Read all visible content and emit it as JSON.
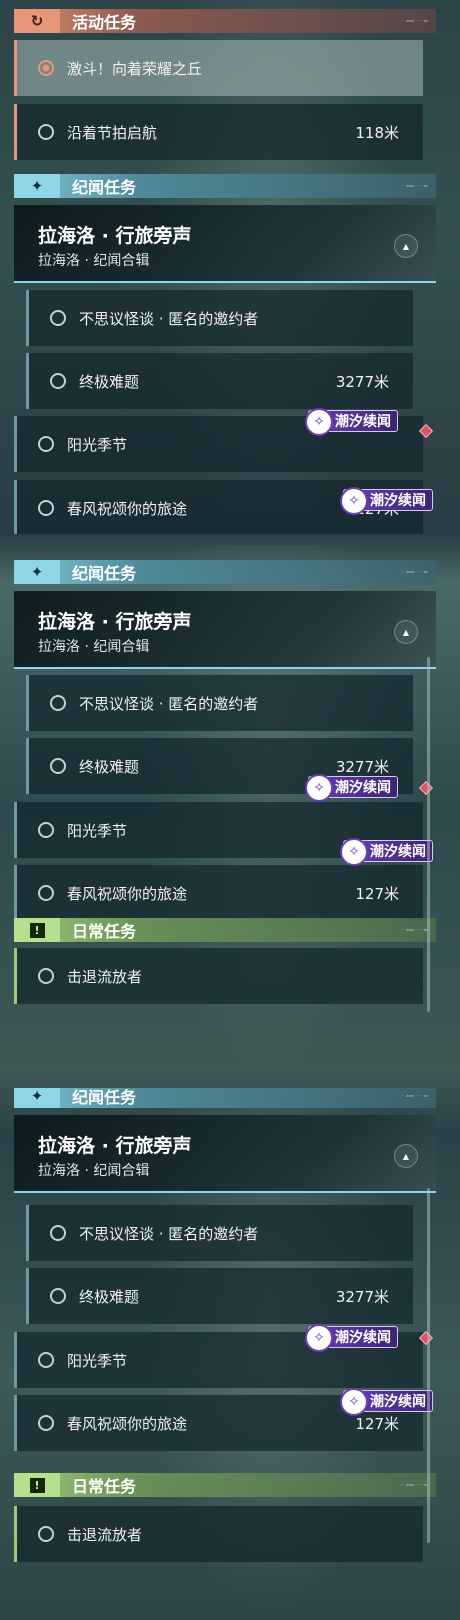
{
  "colors": {
    "activity": "#e8967a",
    "chronicle": "#8fd5e8",
    "daily": "#b6e08e",
    "badge": "#6a3fb0",
    "alert": "#d9556a"
  },
  "icons": {
    "activity": "refresh-icon",
    "chronicle": "sparkle-icon",
    "daily": "exclamation-icon",
    "collapse": "chevron-up-icon",
    "badge": "wave-icon"
  },
  "panel1": {
    "activity": {
      "title": "活动任务",
      "quests": [
        {
          "name": "激斗！向着荣耀之丘",
          "distance": ""
        },
        {
          "name": "沿着节拍启航",
          "distance": "118米"
        }
      ]
    },
    "chronicle": {
      "title": "纪闻任务",
      "group_title": "拉海洛 · 行旅旁声",
      "group_subtitle": "拉海洛 · 纪闻合辑",
      "quests": [
        {
          "name": "不思议怪谈 · 匿名的邀约者",
          "distance": ""
        },
        {
          "name": "终极难题",
          "distance": "3277米"
        },
        {
          "name": "阳光季节",
          "distance": ""
        },
        {
          "name": "春风祝颂你的旅途",
          "distance": "127米"
        }
      ],
      "badge": "潮汐续闻"
    }
  },
  "panel2": {
    "chronicle": {
      "title": "纪闻任务",
      "group_title": "拉海洛 · 行旅旁声",
      "group_subtitle": "拉海洛 · 纪闻合辑",
      "quests": [
        {
          "name": "不思议怪谈 · 匿名的邀约者",
          "distance": ""
        },
        {
          "name": "终极难题",
          "distance": "3277米"
        },
        {
          "name": "阳光季节",
          "distance": ""
        },
        {
          "name": "春风祝颂你的旅途",
          "distance": "127米"
        }
      ],
      "badge": "潮汐续闻"
    },
    "daily": {
      "title": "日常任务",
      "quests": [
        {
          "name": "击退流放者",
          "distance": ""
        }
      ]
    }
  },
  "panel3": {
    "chronicle": {
      "title": "纪闻任务",
      "group_title": "拉海洛 · 行旅旁声",
      "group_subtitle": "拉海洛 · 纪闻合辑",
      "quests": [
        {
          "name": "不思议怪谈 · 匿名的邀约者",
          "distance": ""
        },
        {
          "name": "终极难题",
          "distance": "3277米"
        },
        {
          "name": "阳光季节",
          "distance": ""
        },
        {
          "name": "春风祝颂你的旅途",
          "distance": "127米"
        }
      ],
      "badge": "潮汐续闻"
    },
    "daily": {
      "title": "日常任务",
      "quests": [
        {
          "name": "击退流放者",
          "distance": ""
        }
      ]
    }
  }
}
